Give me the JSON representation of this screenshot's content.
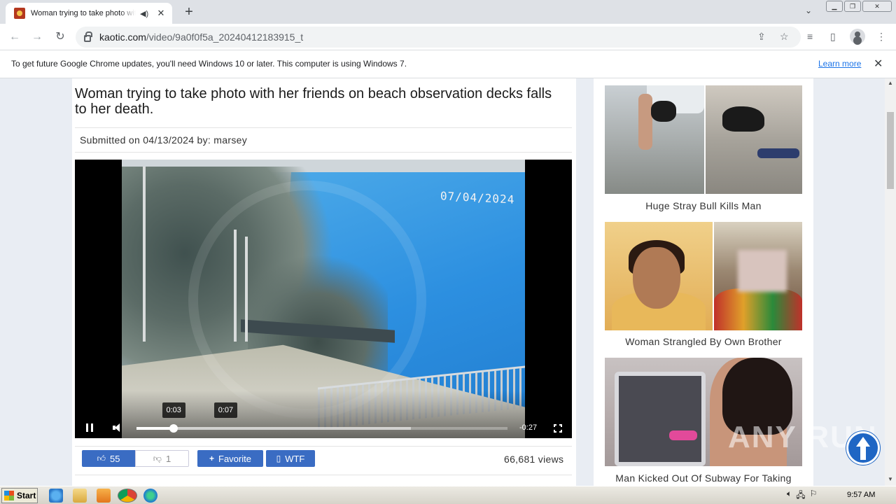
{
  "browser": {
    "tab_title": "Woman trying to take photo with her friends on beach observation decks falls to her death",
    "url_host": "kaotic.com",
    "url_path": "/video/9a0f0f5a_20240412183915_t",
    "infobar_text": "To get future Google Chrome updates, you'll need Windows 10 or later. This computer is using Windows 7.",
    "infobar_link": "Learn more"
  },
  "video": {
    "title": "Woman trying to take photo with her friends on beach observation decks falls to her death.",
    "submitted": "Submitted on 04/13/2024 by: marsey",
    "timestamp_overlay": "07/04/2024",
    "current_time": "0:03",
    "hover_time": "0:07",
    "remaining": "-0:27",
    "progress_fraction": 0.1,
    "buffer_fraction": 0.74,
    "hover_fraction": 0.24
  },
  "actions": {
    "likes": "55",
    "dislikes": "1",
    "favorite": "Favorite",
    "wtf": "WTF",
    "views": "66,681 views"
  },
  "sidebar": [
    {
      "caption": "Huge Stray Bull Kills Man"
    },
    {
      "caption": "Woman Strangled By Own Brother"
    },
    {
      "caption": "Man Kicked Out Of Subway For Taking"
    }
  ],
  "watermark": "ANY RUN",
  "taskbar": {
    "start": "Start",
    "clock": "9:57 AM"
  },
  "colors": {
    "button_blue": "#3a6cc3",
    "link_blue": "#1a73e8"
  }
}
